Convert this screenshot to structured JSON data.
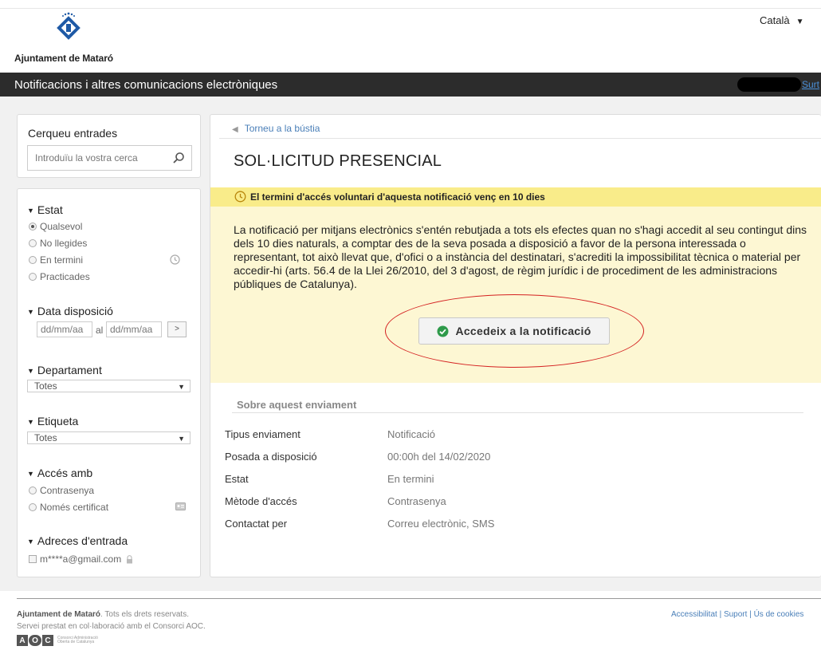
{
  "header": {
    "org_name": "Ajuntament de Mataró",
    "language": "Català",
    "app_title": "Notificacions i altres comunicacions electròniques",
    "logout_label": "Surt"
  },
  "sidebar": {
    "search": {
      "title": "Cerqueu entrades",
      "placeholder": "Introduïu la vostra cerca"
    },
    "filters": {
      "estat": {
        "title": "Estat",
        "options": [
          "Qualsevol",
          "No llegides",
          "En termini",
          "Practicades"
        ],
        "selected": "Qualsevol"
      },
      "data": {
        "title": "Data disposició",
        "from_placeholder": "dd/mm/aa",
        "sep": "al",
        "to_placeholder": "dd/mm/aa",
        "go": ">"
      },
      "departament": {
        "title": "Departament",
        "value": "Totes"
      },
      "etiqueta": {
        "title": "Etiqueta",
        "value": "Totes"
      },
      "acces": {
        "title": "Accés amb",
        "options": [
          "Contrasenya",
          "Només certificat"
        ]
      },
      "adreces": {
        "title": "Adreces d'entrada",
        "email": "m****a@gmail.com"
      }
    }
  },
  "main": {
    "back_label": "Torneu a la bústia",
    "title": "SOL·LICITUD PRESENCIAL",
    "notice_head": "El termini d'accés voluntari d'aquesta notificació venç en 10 dies",
    "notice_body": "La notificació per mitjans electrònics s'entén rebutjada a tots els efectes quan no s'hagi accedit al seu contingut dins dels 10 dies naturals, a comptar des de la seva posada a disposició a favor de la persona interessada o representant, tot això llevat que, d'ofici o a instància del destinatari, s'acrediti la impossibilitat tècnica o material per accedir-hi (arts. 56.4 de la Llei 26/2010, del 3 d'agost, de règim jurídic i de procediment de les administracions públiques de Catalunya).",
    "access_button": "Accedeix a la notificació",
    "about_title": "Sobre aquest enviament",
    "details": [
      {
        "key": "Tipus enviament",
        "value": "Notificació"
      },
      {
        "key": "Posada a disposició",
        "value": "00:00h del 14/02/2020"
      },
      {
        "key": "Estat",
        "value": "En termini"
      },
      {
        "key": "Mètode d'accés",
        "value": "Contrasenya"
      },
      {
        "key": "Contactat per",
        "value": "Correu electrònic, SMS"
      }
    ]
  },
  "footer": {
    "org": "Ajuntament de Mataró",
    "rights": ". Tots els drets reservats.",
    "line2": "Servei prestat en col·laboració amb el Consorci AOC.",
    "links": "Accessibilitat | Suport | Ús de cookies",
    "aoc_letters": [
      "A",
      "O",
      "C"
    ],
    "aoc_small": "Consorci Administració Oberta de Catalunya"
  },
  "colors": {
    "topbar": "#2c2c2c",
    "notice_bar": "#f9ec8a",
    "notice_bg": "#fdf7d3",
    "link": "#4a7fb8",
    "highlight_ellipse": "#d42020",
    "ok_icon": "#2e9a4a"
  },
  "icons": {
    "search": "search-icon",
    "clock": "clock-icon",
    "ok": "check-circle-icon",
    "lock": "lock-icon",
    "certificate": "id-card-icon"
  }
}
